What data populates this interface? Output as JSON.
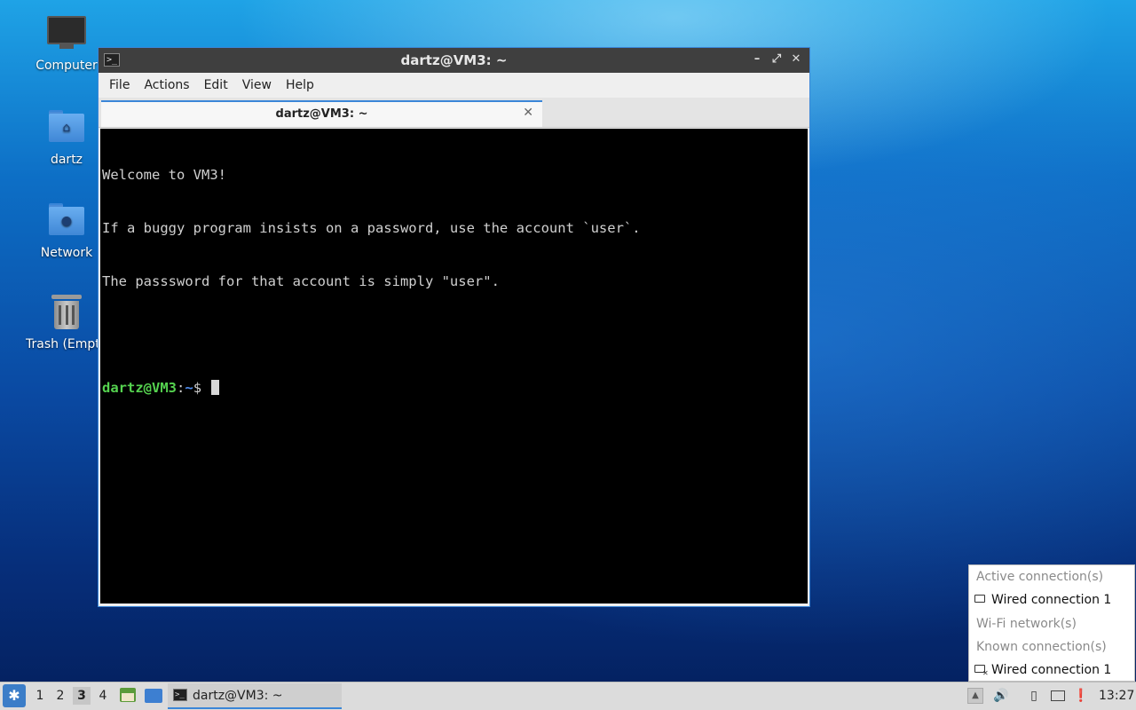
{
  "desktop": {
    "icons": [
      {
        "label": "Computer",
        "icon": "computer-icon"
      },
      {
        "label": "dartz",
        "icon": "home-folder-icon"
      },
      {
        "label": "Network",
        "icon": "network-folder-icon"
      },
      {
        "label": "Trash (Empt",
        "icon": "trash-icon"
      }
    ]
  },
  "window": {
    "title": "dartz@VM3: ~",
    "controls": {
      "minimize": "–",
      "maximize": "⤢",
      "close": "✕"
    },
    "menu": [
      "File",
      "Actions",
      "Edit",
      "View",
      "Help"
    ],
    "tab": {
      "title": "dartz@VM3: ~",
      "close": "✕"
    },
    "terminal": {
      "lines": [
        "Welcome to VM3!",
        "If a buggy program insists on a password, use the account `user`.",
        "The passsword for that account is simply \"user\"."
      ],
      "prompt_user": "dartz@VM3",
      "prompt_sep": ":",
      "prompt_path": "~",
      "prompt_symbol": "$ "
    }
  },
  "network_menu": {
    "active_header": "Active connection(s)",
    "active_item": "Wired connection 1",
    "wifi_header": "Wi-Fi network(s)",
    "known_header": "Known connection(s)",
    "known_item": "Wired connection 1"
  },
  "taskbar": {
    "workspaces": [
      "1",
      "2",
      "3",
      "4"
    ],
    "active_workspace": "3",
    "task_label": "dartz@VM3: ~",
    "clock": "13:27"
  },
  "colors": {
    "accent": "#3a86d8",
    "prompt_user": "#55d24f",
    "prompt_path": "#4f8df0",
    "terminal_bg": "#000000",
    "titlebar_bg": "#3f3f3f"
  }
}
